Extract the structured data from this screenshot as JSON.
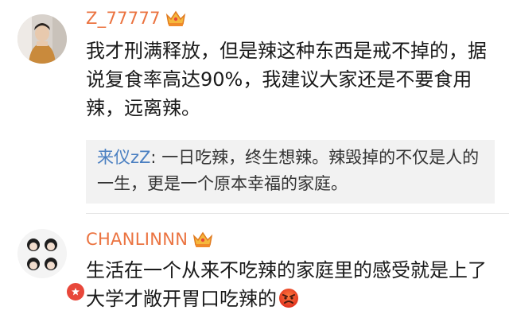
{
  "comments": [
    {
      "username": "Z_77777",
      "text": "我才刑满释放，但是辣这种东西是戒不掉的，据说复食率高达90%，我建议大家还是不要食用辣，远离辣。",
      "reply": {
        "user": "来仪zZ",
        "separator": ": ",
        "text": "一日吃辣，终生想辣。辣毁掉的不仅是人的一生，更是一个原本幸福的家庭。"
      }
    },
    {
      "username": "CHANLINNN",
      "text": "生活在一个从来不吃辣的家庭里的感受就是上了大学才敞开胃口吃辣的"
    }
  ],
  "icons": {
    "crown": "vip-crown-icon",
    "badge": "verified-badge-icon",
    "emoji": "angry-face-emoji"
  },
  "colors": {
    "username": "#eb7340",
    "reply_user": "#4a7fc1",
    "reply_bg": "#f2f2f2",
    "badge": "#e8473a"
  }
}
